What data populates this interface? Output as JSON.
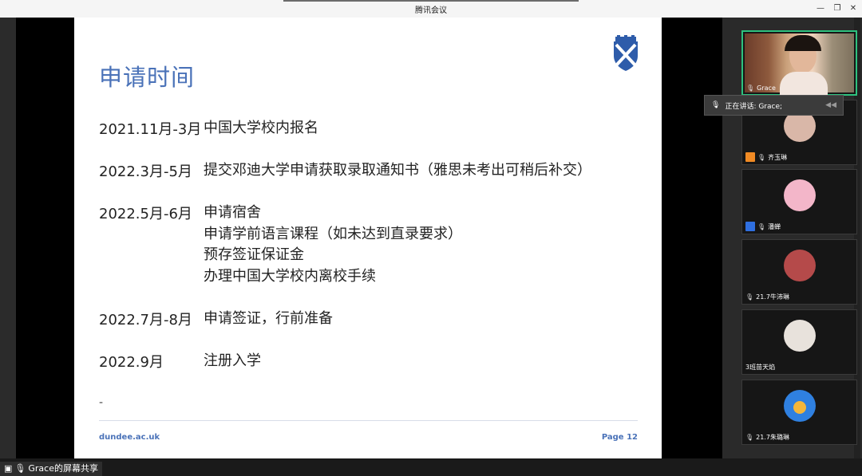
{
  "window": {
    "title": "腾讯会议"
  },
  "slide": {
    "title": "申请时间",
    "timeline": [
      {
        "date": "2021.11月-3月",
        "items": [
          "中国大学校内报名"
        ]
      },
      {
        "date": "2022.3月-5月",
        "items": [
          "提交邓迪大学申请获取录取通知书（雅思未考出可稍后补交）"
        ]
      },
      {
        "date": "2022.5月-6月",
        "items": [
          "申请宿舍",
          "申请学前语言课程（如未达到直录要求）",
          "预存签证保证金",
          "办理中国大学校内离校手续"
        ]
      },
      {
        "date": "2022.7月-8月",
        "items": [
          "申请签证，行前准备"
        ]
      },
      {
        "date": "2022.9月",
        "items": [
          "注册入学"
        ]
      }
    ],
    "dash": "-",
    "footer_left": "dundee.ac.uk",
    "footer_right": "Page  12",
    "accent": "#4a72b8"
  },
  "share_label": "Grace的屏幕共享",
  "speaking": {
    "text": "正在讲话: Grace;"
  },
  "participants": [
    {
      "name": "Grace",
      "video": true
    },
    {
      "name": "齐玉琳",
      "badge_color": "#f08a24"
    },
    {
      "name": "潘蝉",
      "badge_color": "#2f6fe0"
    },
    {
      "name": "21.7牛沛琳"
    },
    {
      "name": "3班苗天焰"
    },
    {
      "name": "21.7朱璐琳"
    }
  ]
}
